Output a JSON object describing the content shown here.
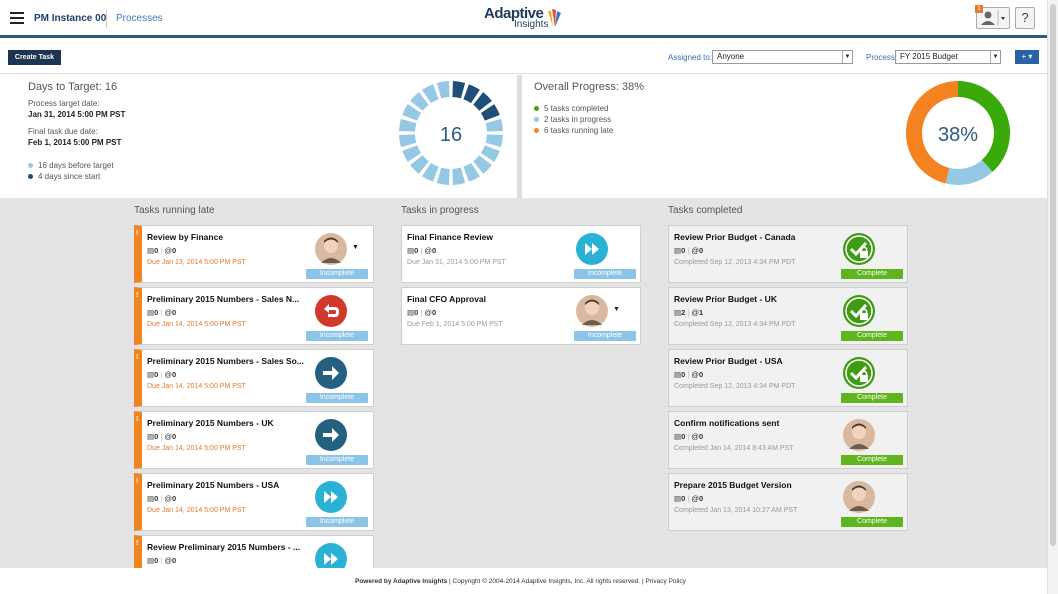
{
  "header": {
    "instance": "PM Instance 00",
    "processes_link": "Processes",
    "logo_line1": "Adaptive",
    "logo_line2": "Insights",
    "notif_count": "1",
    "help": "?"
  },
  "toolbar": {
    "create_task": "Create Task",
    "assigned_label": "Assigned to:",
    "assigned_value": "Anyone",
    "process_label": "Process:",
    "process_value": "FY 2015 Budget",
    "plus": "+ ▾"
  },
  "days": {
    "title": "Days to Target: 16",
    "target_label": "Process target date:",
    "target_value": "Jan 31, 2014 5:00 PM PST",
    "final_label": "Final task due date:",
    "final_value": "Feb 1, 2014 5:00 PM PST",
    "legend_before": "16 days before target",
    "legend_since": "4 days since start",
    "ring_value": "16",
    "ring_total": 20,
    "ring_elapsed": 4,
    "color_before": "#94c8e4",
    "color_since": "#1f4e79"
  },
  "overall": {
    "title": "Overall Progress: 38%",
    "legend_completed": "5 tasks completed",
    "legend_progress": "2 tasks in progress",
    "legend_late": "6 tasks running late",
    "percent_label": "38%",
    "completed": 5,
    "in_progress": 2,
    "late": 6,
    "color_completed": "#3aaa0a",
    "color_progress": "#94c8e4",
    "color_late": "#f58220"
  },
  "columns": {
    "late_title": "Tasks running late",
    "progress_title": "Tasks in progress",
    "completed_title": "Tasks completed"
  },
  "late_tasks": [
    {
      "title": "Review by Finance",
      "docs": "0",
      "comments": "0",
      "due": "Due Jan 13, 2014 5:00 PM PST",
      "status": "Incomplete",
      "icon": "person-avatar"
    },
    {
      "title": "Preliminary 2015 Numbers - Sales N...",
      "docs": "0",
      "comments": "0",
      "due": "Due Jan 14, 2014 5:00 PM PST",
      "status": "Incomplete",
      "icon": "return-icon"
    },
    {
      "title": "Preliminary 2015 Numbers - Sales So...",
      "docs": "0",
      "comments": "0",
      "due": "Due Jan 14, 2014 5:00 PM PST",
      "status": "Incomplete",
      "icon": "arrow-icon"
    },
    {
      "title": "Preliminary 2015 Numbers - UK",
      "docs": "0",
      "comments": "0",
      "due": "Due Jan 14, 2014 5:00 PM PST",
      "status": "Incomplete",
      "icon": "arrow-icon"
    },
    {
      "title": "Preliminary 2015 Numbers - USA",
      "docs": "0",
      "comments": "0",
      "due": "Due Jan 14, 2014 5:00 PM PST",
      "status": "Incomplete",
      "icon": "fast-forward-icon"
    },
    {
      "title": "Review Preliminary 2015 Numbers - ...",
      "docs": "0",
      "comments": "0",
      "due": "",
      "status": "",
      "icon": "fast-forward-icon"
    }
  ],
  "progress_tasks": [
    {
      "title": "Final Finance Review",
      "docs": "0",
      "comments": "0",
      "due": "Due Jan 31, 2014 5:00 PM PST",
      "status": "Incomplete",
      "icon": "fast-forward-icon"
    },
    {
      "title": "Final CFO Approval",
      "docs": "0",
      "comments": "0",
      "due": "Due Feb 1, 2014 5:00 PM PST",
      "status": "Incomplete",
      "icon": "person-avatar"
    }
  ],
  "completed_tasks": [
    {
      "title": "Review Prior Budget - Canada",
      "docs": "0",
      "comments": "0",
      "due": "Completed Sep 12, 2013 4:34 PM PDT",
      "status": "Complete",
      "icon": "check-lock-icon"
    },
    {
      "title": "Review Prior Budget - UK",
      "docs": "2",
      "comments": "1",
      "due": "Completed Sep 12, 2013 4:34 PM PDT",
      "status": "Complete",
      "icon": "check-lock-icon"
    },
    {
      "title": "Review Prior Budget - USA",
      "docs": "0",
      "comments": "0",
      "due": "Completed Sep 12, 2013 4:34 PM PDT",
      "status": "Complete",
      "icon": "check-lock-icon"
    },
    {
      "title": "Confirm notifications sent",
      "docs": "0",
      "comments": "0",
      "due": "Completed Jan 14, 2014 8:43 AM PST",
      "status": "Complete",
      "icon": "person-avatar"
    },
    {
      "title": "Prepare 2015 Budget Version",
      "docs": "0",
      "comments": "0",
      "due": "Completed Jan 13, 2014 10:27 AM PST",
      "status": "Complete",
      "icon": "person-avatar"
    }
  ],
  "footer": {
    "powered": "Powered by Adaptive Insights",
    "copyright": " | Copyright © 2004-2014 Adaptive Insights, Inc. All rights reserved.  |   ",
    "privacy": "Privacy Policy"
  }
}
